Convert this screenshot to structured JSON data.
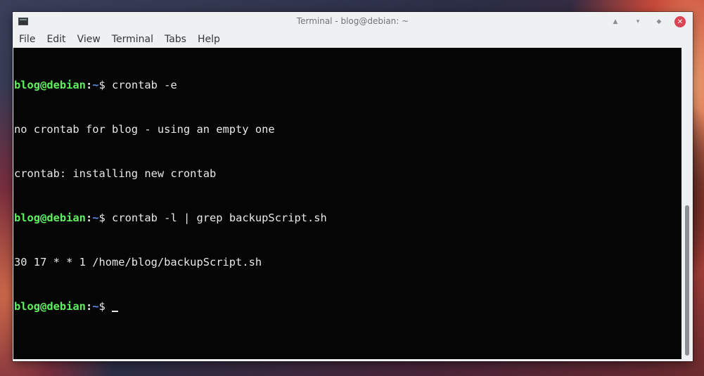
{
  "window": {
    "title": "Terminal - blog@debian: ~"
  },
  "icons": {
    "app": "terminal-icon",
    "keep_above": "keep-above-icon",
    "minimize": "minimize-icon",
    "maximize": "maximize-icon",
    "close": "close-icon"
  },
  "colors": {
    "prompt_user": "#5ff05f",
    "prompt_path": "#5b8de8",
    "terminal_bg": "#050505",
    "text": "#e8e8e8",
    "close_button": "#da4453"
  },
  "menu": {
    "file": "File",
    "edit": "Edit",
    "view": "View",
    "terminal": "Terminal",
    "tabs": "Tabs",
    "help": "Help"
  },
  "terminal": {
    "prompt_user": "blog@debian",
    "prompt_colon": ":",
    "prompt_path": "~",
    "prompt_dollar": "$",
    "cmd1": " crontab -e",
    "out1": "no crontab for blog - using an empty one",
    "out2": "crontab: installing new crontab",
    "cmd2": " crontab -l | grep backupScript.sh",
    "out3": "30 17 * * 1 /home/blog/backupScript.sh",
    "cmd3": " "
  }
}
